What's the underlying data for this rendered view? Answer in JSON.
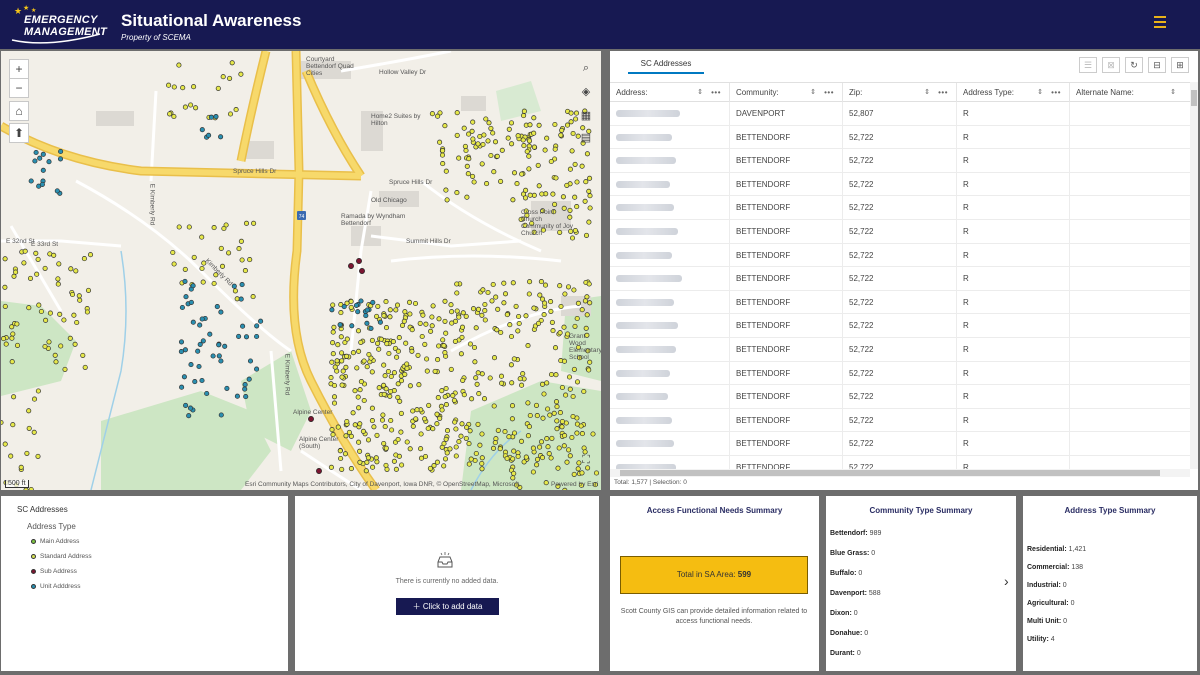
{
  "header": {
    "logo_line1": "EMERGENCY",
    "logo_line2": "MANAGEMENT",
    "title": "Situational Awareness",
    "subtitle": "Property of SCEMA",
    "menu_icon": "hamburger-icon",
    "accent": "#e8b21a",
    "background": "#171952"
  },
  "map": {
    "zoom_in": "+",
    "zoom_out": "−",
    "scale": "500 ft",
    "attribution": "Esri Community Maps Contributors, City of Davenport, Iowa DNR, © OpenStreetMap, Microsoft,",
    "powered_by": "Powered by Esri",
    "labels": {
      "spruce_hills_dr": "Spruce Hills Dr",
      "spruce_hills_dr_2": "Spruce Hills Dr",
      "summit_hills_dr": "Summit Hills Dr",
      "kimberly_rd": "Kimberly Rd",
      "e_kimberly_rd": "E Kimberly Rd",
      "e_kimberly_rd_2": "E Kimberly Rd",
      "e_32nd_st": "E 32nd St",
      "e_33rd_st": "E 33rd St",
      "old_chicago": "Old Chicago",
      "ramada": "Ramada by Wyndham Bettendorf",
      "cross_point": "Cross Point Church Community of Joy Church",
      "courtyard": "Courtyard Bettendorf Quad Cities",
      "alpine_center": "Alpine Center",
      "alpine_center_south": "Alpine Center (South)",
      "grant_wood": "Grant Wood Elementary School",
      "interstate": "74",
      "hollow_valley": "Hollow Valley Dr",
      "home2": "Home2 Suites by Hilton"
    }
  },
  "table": {
    "tab_label": "SC Addresses",
    "columns": [
      "Address:",
      "Community:",
      "Zip:",
      "Address Type:",
      "Alternate Name:"
    ],
    "rows": [
      {
        "community": "DAVENPORT",
        "zip": "52,807",
        "type": "R"
      },
      {
        "community": "BETTENDORF",
        "zip": "52,722",
        "type": "R"
      },
      {
        "community": "BETTENDORF",
        "zip": "52,722",
        "type": "R"
      },
      {
        "community": "BETTENDORF",
        "zip": "52,722",
        "type": "R"
      },
      {
        "community": "BETTENDORF",
        "zip": "52,722",
        "type": "R"
      },
      {
        "community": "BETTENDORF",
        "zip": "52,722",
        "type": "R"
      },
      {
        "community": "BETTENDORF",
        "zip": "52,722",
        "type": "R"
      },
      {
        "community": "BETTENDORF",
        "zip": "52,722",
        "type": "R"
      },
      {
        "community": "BETTENDORF",
        "zip": "52,722",
        "type": "R"
      },
      {
        "community": "BETTENDORF",
        "zip": "52,722",
        "type": "R"
      },
      {
        "community": "BETTENDORF",
        "zip": "52,722",
        "type": "R"
      },
      {
        "community": "BETTENDORF",
        "zip": "52,722",
        "type": "R"
      },
      {
        "community": "BETTENDORF",
        "zip": "52,722",
        "type": "R"
      },
      {
        "community": "BETTENDORF",
        "zip": "52,722",
        "type": "R"
      },
      {
        "community": "BETTENDORF",
        "zip": "52,722",
        "type": "R"
      },
      {
        "community": "BETTENDORF",
        "zip": "52,722",
        "type": "R"
      }
    ],
    "footer": "Total: 1,577 | Selection: 0",
    "tools": [
      "show-selected-icon",
      "clear-selection-icon",
      "refresh-icon",
      "filter-icon",
      "grid-icon"
    ]
  },
  "legend": {
    "title": "SC Addresses",
    "subtitle": "Address Type",
    "items": [
      {
        "label": "Main Address",
        "color": "#7cc242"
      },
      {
        "label": "Standard Address",
        "color": "#d4e157"
      },
      {
        "label": "Sub Address",
        "color": "#7b1530"
      },
      {
        "label": "Unit Adddress",
        "color": "#2a8fb0"
      }
    ]
  },
  "added_data": {
    "empty_text": "There is currently no added data.",
    "button_label": "Click to add data"
  },
  "afn": {
    "title": "Access Functional Needs Summary",
    "total_label": "Total in SA Area:",
    "total_value": "599",
    "note": "Scott County GIS can provide detailed information related to access functional needs.",
    "box_color": "#f5bd11"
  },
  "community": {
    "title": "Community Type Summary",
    "items": [
      {
        "name": "Bettendorf:",
        "value": "989"
      },
      {
        "name": "Blue Grass:",
        "value": "0"
      },
      {
        "name": "Buffalo:",
        "value": "0"
      },
      {
        "name": "Davenport:",
        "value": "588"
      },
      {
        "name": "Dixon:",
        "value": "0"
      },
      {
        "name": "Donahue:",
        "value": "0"
      },
      {
        "name": "Durant:",
        "value": "0"
      }
    ]
  },
  "address_type": {
    "title": "Address Type Summary",
    "items": [
      {
        "name": "Residential:",
        "value": "1,421"
      },
      {
        "name": "Commercial:",
        "value": "138"
      },
      {
        "name": "Industrial:",
        "value": "0"
      },
      {
        "name": "Agricultural:",
        "value": "0"
      },
      {
        "name": "Multi Unit:",
        "value": "0"
      },
      {
        "name": "Utility:",
        "value": "4"
      }
    ]
  }
}
